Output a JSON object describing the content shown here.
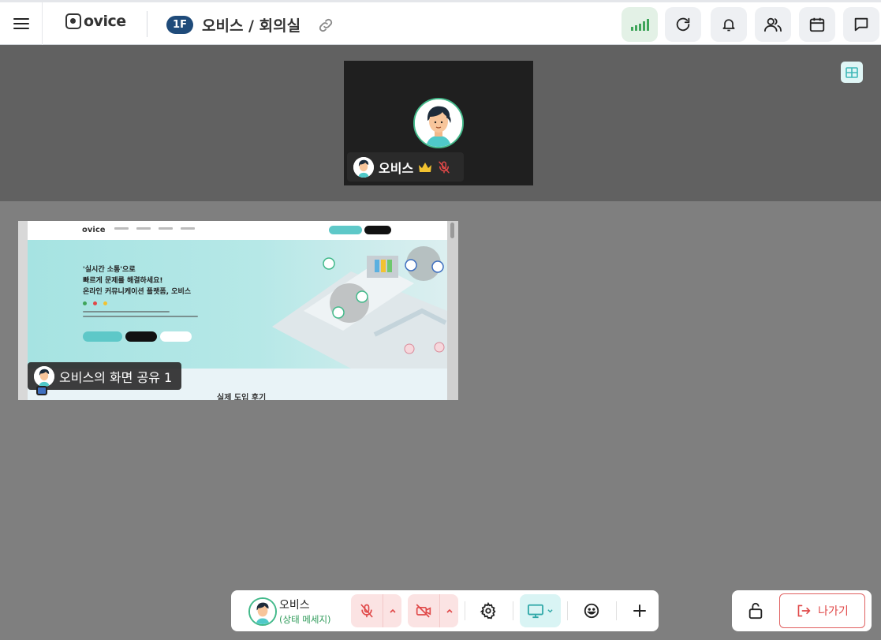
{
  "header": {
    "logo_text": "ovice",
    "floor_badge": "1F",
    "room_title": "오비스 / 회의실",
    "buttons": [
      {
        "name": "signal-strength",
        "icon": "signal-bars-icon"
      },
      {
        "name": "refresh",
        "icon": "refresh-icon"
      },
      {
        "name": "notifications",
        "icon": "bell-icon"
      },
      {
        "name": "members",
        "icon": "people-icon"
      },
      {
        "name": "calendar",
        "icon": "calendar-icon"
      },
      {
        "name": "chat",
        "icon": "chat-icon"
      }
    ],
    "signal_level": 5
  },
  "speaker": {
    "name": "오비스",
    "is_host": true,
    "muted": true
  },
  "screen_share": {
    "label": "오비스의 화면 공유 1",
    "content": {
      "logo": "ovice",
      "hero_lines": [
        "'실시간 소통'으로",
        "빠르게 문제를 해결하세요!",
        "온라인 커뮤니케이션 플랫폼, 오비스"
      ],
      "footer_heading": "실제 도입 후기"
    }
  },
  "toolbar": {
    "user_name": "오비스",
    "status_message": "(상태 메세지)",
    "mic_muted": true,
    "camera_off": true,
    "screen_share_active": true
  },
  "exit": {
    "label": "나가기"
  },
  "colors": {
    "accent_teal": "#5ec8c8",
    "danger": "#e04848",
    "status_green": "#2f9b5a",
    "floor_badge": "#1f4b7a"
  }
}
